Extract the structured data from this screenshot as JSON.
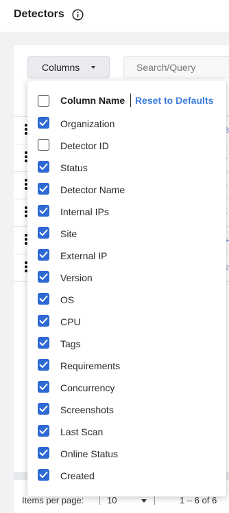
{
  "header": {
    "title": "Detectors",
    "info_icon": "info-circle-icon"
  },
  "toolbar": {
    "columns_label": "Columns",
    "search_placeholder": "Search/Query"
  },
  "table": {
    "row_count": 6,
    "row_edge_glyphs": [
      "3",
      "-",
      "-",
      "-",
      "+",
      "2"
    ]
  },
  "column_menu": {
    "header_label": "Column Name",
    "reset_label": "Reset to Defaults",
    "options": [
      {
        "label": "Organization",
        "checked": true
      },
      {
        "label": "Detector ID",
        "checked": false
      },
      {
        "label": "Status",
        "checked": true
      },
      {
        "label": "Detector Name",
        "checked": true
      },
      {
        "label": "Internal IPs",
        "checked": true
      },
      {
        "label": "Site",
        "checked": true
      },
      {
        "label": "External IP",
        "checked": true
      },
      {
        "label": "Version",
        "checked": true
      },
      {
        "label": "OS",
        "checked": true
      },
      {
        "label": "CPU",
        "checked": true
      },
      {
        "label": "Tags",
        "checked": true
      },
      {
        "label": "Requirements",
        "checked": true
      },
      {
        "label": "Concurrency",
        "checked": true
      },
      {
        "label": "Screenshots",
        "checked": true
      },
      {
        "label": "Last Scan",
        "checked": true
      },
      {
        "label": "Online Status",
        "checked": true
      },
      {
        "label": "Created",
        "checked": true
      }
    ]
  },
  "footer": {
    "items_per_page_label": "Items per page:",
    "page_size": "10",
    "range_label": "1 – 6 of 6"
  },
  "colors": {
    "accent": "#2e69d4",
    "link": "#3d7ddb"
  }
}
